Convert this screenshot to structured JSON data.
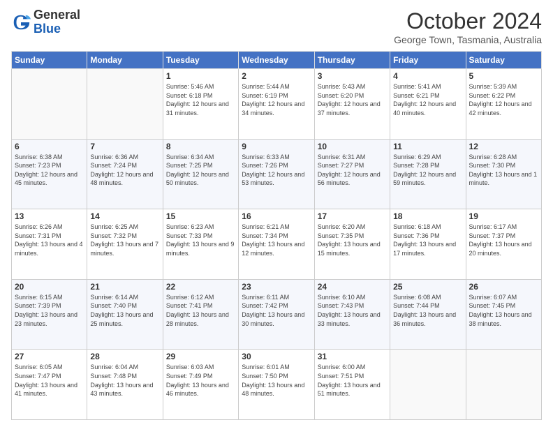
{
  "header": {
    "logo_general": "General",
    "logo_blue": "Blue",
    "month": "October 2024",
    "location": "George Town, Tasmania, Australia"
  },
  "weekdays": [
    "Sunday",
    "Monday",
    "Tuesday",
    "Wednesday",
    "Thursday",
    "Friday",
    "Saturday"
  ],
  "weeks": [
    [
      {
        "day": "",
        "info": ""
      },
      {
        "day": "",
        "info": ""
      },
      {
        "day": "1",
        "info": "Sunrise: 5:46 AM\nSunset: 6:18 PM\nDaylight: 12 hours and 31 minutes."
      },
      {
        "day": "2",
        "info": "Sunrise: 5:44 AM\nSunset: 6:19 PM\nDaylight: 12 hours and 34 minutes."
      },
      {
        "day": "3",
        "info": "Sunrise: 5:43 AM\nSunset: 6:20 PM\nDaylight: 12 hours and 37 minutes."
      },
      {
        "day": "4",
        "info": "Sunrise: 5:41 AM\nSunset: 6:21 PM\nDaylight: 12 hours and 40 minutes."
      },
      {
        "day": "5",
        "info": "Sunrise: 5:39 AM\nSunset: 6:22 PM\nDaylight: 12 hours and 42 minutes."
      }
    ],
    [
      {
        "day": "6",
        "info": "Sunrise: 6:38 AM\nSunset: 7:23 PM\nDaylight: 12 hours and 45 minutes."
      },
      {
        "day": "7",
        "info": "Sunrise: 6:36 AM\nSunset: 7:24 PM\nDaylight: 12 hours and 48 minutes."
      },
      {
        "day": "8",
        "info": "Sunrise: 6:34 AM\nSunset: 7:25 PM\nDaylight: 12 hours and 50 minutes."
      },
      {
        "day": "9",
        "info": "Sunrise: 6:33 AM\nSunset: 7:26 PM\nDaylight: 12 hours and 53 minutes."
      },
      {
        "day": "10",
        "info": "Sunrise: 6:31 AM\nSunset: 7:27 PM\nDaylight: 12 hours and 56 minutes."
      },
      {
        "day": "11",
        "info": "Sunrise: 6:29 AM\nSunset: 7:28 PM\nDaylight: 12 hours and 59 minutes."
      },
      {
        "day": "12",
        "info": "Sunrise: 6:28 AM\nSunset: 7:30 PM\nDaylight: 13 hours and 1 minute."
      }
    ],
    [
      {
        "day": "13",
        "info": "Sunrise: 6:26 AM\nSunset: 7:31 PM\nDaylight: 13 hours and 4 minutes."
      },
      {
        "day": "14",
        "info": "Sunrise: 6:25 AM\nSunset: 7:32 PM\nDaylight: 13 hours and 7 minutes."
      },
      {
        "day": "15",
        "info": "Sunrise: 6:23 AM\nSunset: 7:33 PM\nDaylight: 13 hours and 9 minutes."
      },
      {
        "day": "16",
        "info": "Sunrise: 6:21 AM\nSunset: 7:34 PM\nDaylight: 13 hours and 12 minutes."
      },
      {
        "day": "17",
        "info": "Sunrise: 6:20 AM\nSunset: 7:35 PM\nDaylight: 13 hours and 15 minutes."
      },
      {
        "day": "18",
        "info": "Sunrise: 6:18 AM\nSunset: 7:36 PM\nDaylight: 13 hours and 17 minutes."
      },
      {
        "day": "19",
        "info": "Sunrise: 6:17 AM\nSunset: 7:37 PM\nDaylight: 13 hours and 20 minutes."
      }
    ],
    [
      {
        "day": "20",
        "info": "Sunrise: 6:15 AM\nSunset: 7:39 PM\nDaylight: 13 hours and 23 minutes."
      },
      {
        "day": "21",
        "info": "Sunrise: 6:14 AM\nSunset: 7:40 PM\nDaylight: 13 hours and 25 minutes."
      },
      {
        "day": "22",
        "info": "Sunrise: 6:12 AM\nSunset: 7:41 PM\nDaylight: 13 hours and 28 minutes."
      },
      {
        "day": "23",
        "info": "Sunrise: 6:11 AM\nSunset: 7:42 PM\nDaylight: 13 hours and 30 minutes."
      },
      {
        "day": "24",
        "info": "Sunrise: 6:10 AM\nSunset: 7:43 PM\nDaylight: 13 hours and 33 minutes."
      },
      {
        "day": "25",
        "info": "Sunrise: 6:08 AM\nSunset: 7:44 PM\nDaylight: 13 hours and 36 minutes."
      },
      {
        "day": "26",
        "info": "Sunrise: 6:07 AM\nSunset: 7:45 PM\nDaylight: 13 hours and 38 minutes."
      }
    ],
    [
      {
        "day": "27",
        "info": "Sunrise: 6:05 AM\nSunset: 7:47 PM\nDaylight: 13 hours and 41 minutes."
      },
      {
        "day": "28",
        "info": "Sunrise: 6:04 AM\nSunset: 7:48 PM\nDaylight: 13 hours and 43 minutes."
      },
      {
        "day": "29",
        "info": "Sunrise: 6:03 AM\nSunset: 7:49 PM\nDaylight: 13 hours and 46 minutes."
      },
      {
        "day": "30",
        "info": "Sunrise: 6:01 AM\nSunset: 7:50 PM\nDaylight: 13 hours and 48 minutes."
      },
      {
        "day": "31",
        "info": "Sunrise: 6:00 AM\nSunset: 7:51 PM\nDaylight: 13 hours and 51 minutes."
      },
      {
        "day": "",
        "info": ""
      },
      {
        "day": "",
        "info": ""
      }
    ]
  ]
}
